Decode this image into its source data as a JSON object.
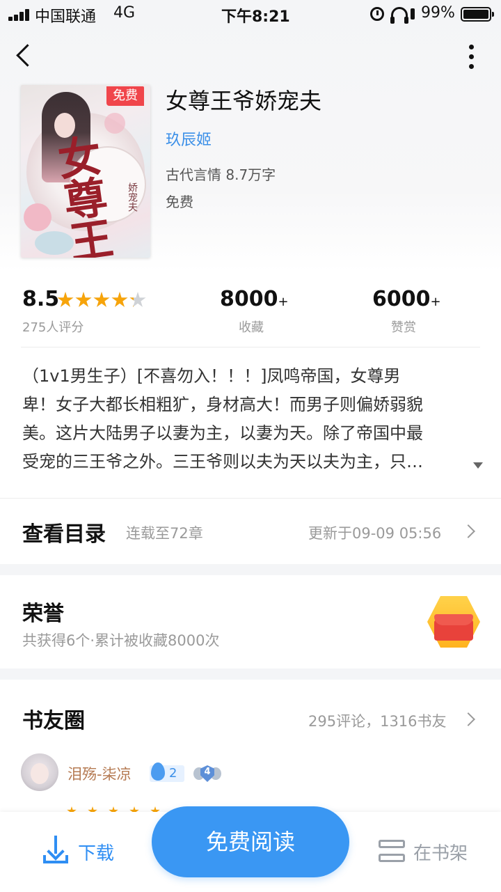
{
  "status_bar": {
    "carrier": "中国联通",
    "network": "4G",
    "time": "下午8:21",
    "battery": "99%",
    "battery_level": 0.99
  },
  "nav": {
    "back_icon": "chevron-left-icon",
    "more_icon": "vertical-ellipsis-icon"
  },
  "book": {
    "cover_badge": "免费",
    "cover_title": "女尊王爷",
    "cover_subtitle": "娇宠夫",
    "title": "女尊王爷娇宠夫",
    "author": "玖辰姬",
    "meta": "古代言情 8.7万字",
    "price": "免费"
  },
  "stats": {
    "rating": "8.5",
    "rating_stars": 4.25,
    "rating_count": "275人评分",
    "favorites": "8000",
    "favorites_suffix": "+",
    "favorites_label": "收藏",
    "rewards": "6000",
    "rewards_suffix": "+",
    "rewards_label": "赞赏"
  },
  "intro": {
    "lines": [
      "（1v1男生子）[不喜勿入！！！]凤鸣帝国，女尊男",
      "卑！女子大都长相粗犷，身材高大！而男子则偏娇弱貌",
      "美。这片大陆男子以妻为主，以妻为天。除了帝国中最",
      "受宠的三王爷之外。三王爷则以夫为天以夫为主，只…"
    ],
    "expand_icon": "caret-down-icon"
  },
  "catalog": {
    "title": "查看目录",
    "status": "连载至72章",
    "updated": "更新于09-09 05:56"
  },
  "honor": {
    "title": "荣誉",
    "summary": "共获得6个·累计被收藏8000次",
    "icon": "red-envelope-badge-icon"
  },
  "circle": {
    "title": "书友圈",
    "summary": "295评论，1316书友",
    "first_user": {
      "name": "泪殇-柒凉",
      "fan_level": "2",
      "vip_level": "4"
    }
  },
  "bottom_bar": {
    "download_label": "下载",
    "read_label": "免费阅读",
    "shelf_label": "在书架"
  },
  "colors": {
    "accent": "#3a97f3",
    "star": "#f7a40a",
    "badge_red": "#f0454b",
    "author_blue": "#3b8fe8"
  }
}
